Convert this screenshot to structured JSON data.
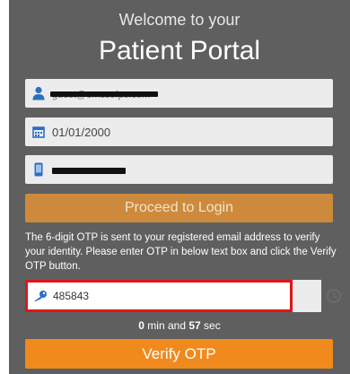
{
  "header": {
    "welcome": "Welcome to your",
    "title": "Patient Portal"
  },
  "form": {
    "email_value": "guest@emcsofpc.com",
    "dob_value": "01/01/2000",
    "phone_value": "",
    "proceed_label": "Proceed to Login"
  },
  "otp": {
    "info": "The 6-digit OTP is sent to your registered email address to verify your identity. Please enter OTP in below text box and click the Verify OTP button.",
    "value": "485843",
    "timer_min": "0",
    "timer_min_label": "min and",
    "timer_sec": "57",
    "timer_sec_label": "sec",
    "verify_label": "Verify OTP"
  },
  "colors": {
    "panel": "#5f5f5f",
    "proceed": "#cd8a3c",
    "verify": "#f08a1c",
    "otp_border": "#e0141b",
    "icon_blue": "#2b6fc1"
  },
  "icons": {
    "email": "user-icon",
    "dob": "calendar-icon",
    "phone": "mobile-phone-icon",
    "otp": "key-icon",
    "resend": "refresh-icon"
  }
}
